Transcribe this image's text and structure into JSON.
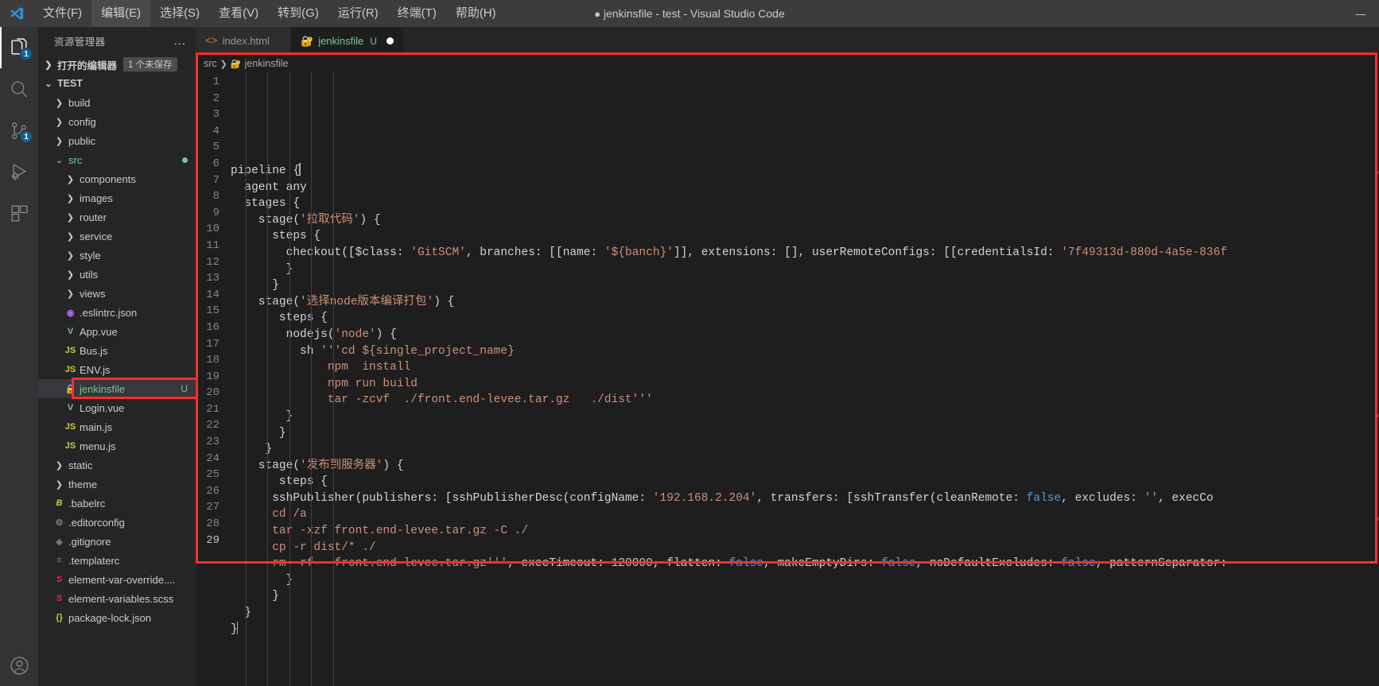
{
  "titlebar": {
    "app_title": "jenkinsfile - test - Visual Studio Code",
    "unsaved_dot": "●",
    "menus": [
      {
        "label": "文件(F)",
        "name": "menu-file"
      },
      {
        "label": "编辑(E)",
        "name": "menu-edit"
      },
      {
        "label": "选择(S)",
        "name": "menu-selection"
      },
      {
        "label": "查看(V)",
        "name": "menu-view"
      },
      {
        "label": "转到(G)",
        "name": "menu-go"
      },
      {
        "label": "运行(R)",
        "name": "menu-run"
      },
      {
        "label": "终端(T)",
        "name": "menu-terminal"
      },
      {
        "label": "帮助(H)",
        "name": "menu-help"
      }
    ],
    "window_controls": {
      "minimize": "—"
    }
  },
  "activitybar": {
    "items": [
      {
        "name": "explorer-icon",
        "badge": "1",
        "active": true
      },
      {
        "name": "search-icon",
        "badge": "",
        "active": false
      },
      {
        "name": "source-control-icon",
        "badge": "1",
        "active": false
      },
      {
        "name": "run-and-debug-icon",
        "badge": "",
        "active": false
      },
      {
        "name": "extensions-icon",
        "badge": "",
        "active": false
      }
    ],
    "account_icon": "account-icon"
  },
  "sidebar": {
    "title": "资源管理器",
    "more_actions": "...",
    "open_editors": {
      "label": "打开的编辑器",
      "badge": "1 个未保存"
    },
    "workspace": {
      "label": "TEST"
    },
    "tree": [
      {
        "label": "build",
        "type": "folder",
        "depth": 1,
        "icon": "chevron-right-icon"
      },
      {
        "label": "config",
        "type": "folder",
        "depth": 1,
        "icon": "chevron-right-icon"
      },
      {
        "label": "public",
        "type": "folder",
        "depth": 1,
        "icon": "chevron-right-icon"
      },
      {
        "label": "src",
        "type": "folder-open",
        "depth": 1,
        "icon": "chevron-down-icon",
        "modified": true,
        "color": "green"
      },
      {
        "label": "components",
        "type": "folder",
        "depth": 2,
        "icon": "chevron-right-icon"
      },
      {
        "label": "images",
        "type": "folder",
        "depth": 2,
        "icon": "chevron-right-icon"
      },
      {
        "label": "router",
        "type": "folder",
        "depth": 2,
        "icon": "chevron-right-icon"
      },
      {
        "label": "service",
        "type": "folder",
        "depth": 2,
        "icon": "chevron-right-icon"
      },
      {
        "label": "style",
        "type": "folder",
        "depth": 2,
        "icon": "chevron-right-icon"
      },
      {
        "label": "utils",
        "type": "folder",
        "depth": 2,
        "icon": "chevron-right-icon"
      },
      {
        "label": "views",
        "type": "folder",
        "depth": 2,
        "icon": "chevron-right-icon"
      },
      {
        "label": ".eslintrc.json",
        "type": "file",
        "depth": 2,
        "icon": "eslint-icon"
      },
      {
        "label": "App.vue",
        "type": "file",
        "depth": 2,
        "icon": "vue-icon"
      },
      {
        "label": "Bus.js",
        "type": "file",
        "depth": 2,
        "icon": "js-icon"
      },
      {
        "label": "ENV.js",
        "type": "file",
        "depth": 2,
        "icon": "js-icon"
      },
      {
        "label": "jenkinsfile",
        "type": "file",
        "depth": 2,
        "icon": "jenkins-icon",
        "status": "U",
        "selected": true
      },
      {
        "label": "Login.vue",
        "type": "file",
        "depth": 2,
        "icon": "vue-icon"
      },
      {
        "label": "main.js",
        "type": "file",
        "depth": 2,
        "icon": "js-icon"
      },
      {
        "label": "menu.js",
        "type": "file",
        "depth": 2,
        "icon": "js-icon"
      },
      {
        "label": "static",
        "type": "folder",
        "depth": 1,
        "icon": "chevron-right-icon"
      },
      {
        "label": "theme",
        "type": "folder",
        "depth": 1,
        "icon": "chevron-right-icon"
      },
      {
        "label": ".babelrc",
        "type": "file",
        "depth": 1,
        "icon": "babel-icon"
      },
      {
        "label": ".editorconfig",
        "type": "file",
        "depth": 1,
        "icon": "gear-icon"
      },
      {
        "label": ".gitignore",
        "type": "file",
        "depth": 1,
        "icon": "git-icon"
      },
      {
        "label": ".templaterc",
        "type": "file",
        "depth": 1,
        "icon": "list-icon"
      },
      {
        "label": "element-var-override....",
        "type": "file",
        "depth": 1,
        "icon": "sass-icon"
      },
      {
        "label": "element-variables.scss",
        "type": "file",
        "depth": 1,
        "icon": "sass-icon"
      },
      {
        "label": "package-lock.json",
        "type": "file",
        "depth": 1,
        "icon": "json-icon"
      }
    ]
  },
  "tabs": [
    {
      "label": "index.html",
      "icon": "html-icon",
      "active": false,
      "status": "",
      "dirty": false
    },
    {
      "label": "jenkinsfile",
      "icon": "jenkins-icon",
      "active": true,
      "status": "U",
      "dirty": true
    }
  ],
  "breadcrumb": {
    "parts": [
      "src",
      "jenkinsfile"
    ],
    "separator": "❯",
    "icon": "jenkins-icon"
  },
  "editor": {
    "cursor_line": 29,
    "lines": [
      {
        "n": 1,
        "tokens": [
          {
            "t": "pipeline ",
            "c": "def"
          },
          {
            "t": "{",
            "c": "punct"
          },
          {
            "t": "CURSOR",
            "c": "cursor"
          }
        ]
      },
      {
        "n": 2,
        "tokens": [
          {
            "t": "  agent any",
            "c": "def"
          }
        ]
      },
      {
        "n": 3,
        "tokens": [
          {
            "t": "  stages {",
            "c": "def"
          }
        ]
      },
      {
        "n": 4,
        "tokens": [
          {
            "t": "    stage(",
            "c": "def"
          },
          {
            "t": "'拉取代码'",
            "c": "str"
          },
          {
            "t": ") {",
            "c": "def"
          }
        ]
      },
      {
        "n": 5,
        "tokens": [
          {
            "t": "      steps {",
            "c": "def"
          }
        ]
      },
      {
        "n": 6,
        "tokens": [
          {
            "t": "        checkout([$class: ",
            "c": "def"
          },
          {
            "t": "'GitSCM'",
            "c": "str"
          },
          {
            "t": ", branches: [[name: ",
            "c": "def"
          },
          {
            "t": "'${banch}'",
            "c": "str"
          },
          {
            "t": "]], extensions: [], userRemoteConfigs: [[credentialsId: ",
            "c": "def"
          },
          {
            "t": "'7f49313d-880d-4a5e-836f",
            "c": "str"
          }
        ]
      },
      {
        "n": 7,
        "tokens": [
          {
            "t": "        }",
            "c": "def"
          }
        ]
      },
      {
        "n": 8,
        "tokens": [
          {
            "t": "      }",
            "c": "def"
          }
        ]
      },
      {
        "n": 9,
        "tokens": [
          {
            "t": "    stage(",
            "c": "def"
          },
          {
            "t": "'选择node版本编译打包'",
            "c": "str"
          },
          {
            "t": ") {",
            "c": "def"
          }
        ]
      },
      {
        "n": 10,
        "tokens": [
          {
            "t": "       steps {",
            "c": "def"
          }
        ]
      },
      {
        "n": 11,
        "tokens": [
          {
            "t": "        nodejs(",
            "c": "def"
          },
          {
            "t": "'node'",
            "c": "str"
          },
          {
            "t": ") {",
            "c": "def"
          }
        ]
      },
      {
        "n": 12,
        "tokens": [
          {
            "t": "          sh ",
            "c": "def"
          },
          {
            "t": "'''cd ${single_project_name}",
            "c": "str"
          }
        ]
      },
      {
        "n": 13,
        "tokens": [
          {
            "t": "              npm  install",
            "c": "str"
          }
        ]
      },
      {
        "n": 14,
        "tokens": [
          {
            "t": "              npm run build",
            "c": "str"
          }
        ]
      },
      {
        "n": 15,
        "tokens": [
          {
            "t": "              tar -zcvf  ./front.end-levee.tar.gz   ./dist'''",
            "c": "str"
          }
        ]
      },
      {
        "n": 16,
        "tokens": [
          {
            "t": "        }",
            "c": "def"
          }
        ]
      },
      {
        "n": 17,
        "tokens": [
          {
            "t": "       }",
            "c": "def"
          }
        ]
      },
      {
        "n": 18,
        "tokens": [
          {
            "t": "     }",
            "c": "def"
          }
        ]
      },
      {
        "n": 19,
        "tokens": [
          {
            "t": "    stage(",
            "c": "def"
          },
          {
            "t": "'发布到服务器'",
            "c": "str"
          },
          {
            "t": ") {",
            "c": "def"
          }
        ]
      },
      {
        "n": 20,
        "tokens": [
          {
            "t": "       steps {",
            "c": "def"
          }
        ]
      },
      {
        "n": 21,
        "tokens": [
          {
            "t": "      sshPublisher(publishers: [sshPublisherDesc(configName: ",
            "c": "def"
          },
          {
            "t": "'192.168.2.204'",
            "c": "str"
          },
          {
            "t": ", transfers: [sshTransfer(cleanRemote: ",
            "c": "def"
          },
          {
            "t": "false",
            "c": "kw"
          },
          {
            "t": ", excludes: ",
            "c": "def"
          },
          {
            "t": "''",
            "c": "str"
          },
          {
            "t": ", execCo",
            "c": "def"
          }
        ]
      },
      {
        "n": 22,
        "tokens": [
          {
            "t": "      cd /a",
            "c": "str"
          }
        ]
      },
      {
        "n": 23,
        "tokens": [
          {
            "t": "      tar -xzf front.end-levee.tar.gz -C ./",
            "c": "str"
          }
        ]
      },
      {
        "n": 24,
        "tokens": [
          {
            "t": "      cp -r dist/* ./",
            "c": "str"
          }
        ]
      },
      {
        "n": 25,
        "tokens": [
          {
            "t": "      rm -rf   front.end-levee.tar.gz'''",
            "c": "str"
          },
          {
            "t": ", execTimeout: ",
            "c": "def"
          },
          {
            "t": "120000",
            "c": "num"
          },
          {
            "t": ", flatten: ",
            "c": "def"
          },
          {
            "t": "false",
            "c": "kw"
          },
          {
            "t": ", makeEmptyDirs: ",
            "c": "def"
          },
          {
            "t": "false",
            "c": "kw"
          },
          {
            "t": ", noDefaultExcludes: ",
            "c": "def"
          },
          {
            "t": "false",
            "c": "kw"
          },
          {
            "t": ", patternSeparator:",
            "c": "def"
          }
        ]
      },
      {
        "n": 26,
        "tokens": [
          {
            "t": "        }",
            "c": "def"
          }
        ]
      },
      {
        "n": 27,
        "tokens": [
          {
            "t": "      }",
            "c": "def"
          }
        ]
      },
      {
        "n": 28,
        "tokens": [
          {
            "t": "  }",
            "c": "def"
          }
        ]
      },
      {
        "n": 29,
        "tokens": [
          {
            "t": "}",
            "c": "def"
          },
          {
            "t": "CURSOR",
            "c": "cursor"
          }
        ]
      }
    ]
  },
  "colors": {
    "accent_red": "#ff2d2d",
    "editor_bg": "#1e1e1e",
    "sidebar_bg": "#252526",
    "activitybar_bg": "#333333",
    "titlebar_bg": "#3c3c3c",
    "string": "#ce9178",
    "keyword": "#569cd6",
    "number": "#b5cea8",
    "green_status": "#73c991"
  }
}
